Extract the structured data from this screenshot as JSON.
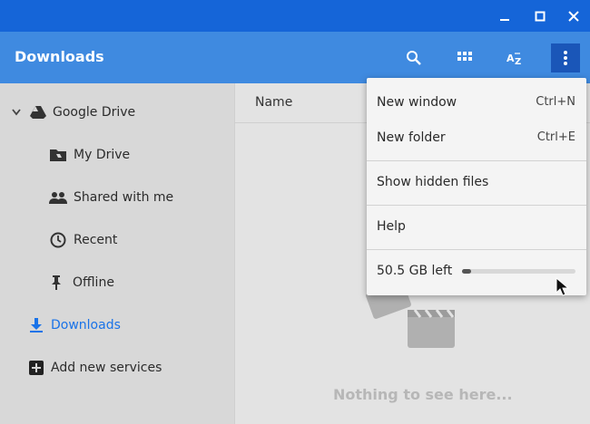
{
  "window": {
    "minimize_icon": "minimize-icon",
    "maximize_icon": "maximize-icon",
    "close_icon": "close-icon"
  },
  "header": {
    "title": "Downloads",
    "search_icon": "search-icon",
    "grid_icon": "grid-view-icon",
    "sort_icon": "sort-az-icon",
    "more_icon": "more-vert-icon"
  },
  "sidebar": {
    "items": [
      {
        "label": "Google Drive",
        "icon": "drive-icon",
        "expand_icon": "chevron-down-icon"
      },
      {
        "label": "My Drive",
        "icon": "folder-icon"
      },
      {
        "label": "Shared with me",
        "icon": "people-icon"
      },
      {
        "label": "Recent",
        "icon": "clock-icon"
      },
      {
        "label": "Offline",
        "icon": "pin-icon"
      },
      {
        "label": "Downloads",
        "icon": "download-icon",
        "selected": true
      },
      {
        "label": "Add new services",
        "icon": "add-box-icon"
      }
    ]
  },
  "main": {
    "column_name": "Name",
    "empty_text": "Nothing to see here..."
  },
  "menu": {
    "items": [
      {
        "label": "New window",
        "shortcut": "Ctrl+N"
      },
      {
        "label": "New folder",
        "shortcut": "Ctrl+E"
      },
      {
        "label": "Show hidden files"
      },
      {
        "label": "Help"
      }
    ],
    "storage": {
      "label": "50.5 GB left",
      "used_fraction": 0.08
    }
  },
  "colors": {
    "titlebar": "#1565d8",
    "appbar": "#3f8ae0",
    "accent": "#1a73e8"
  }
}
